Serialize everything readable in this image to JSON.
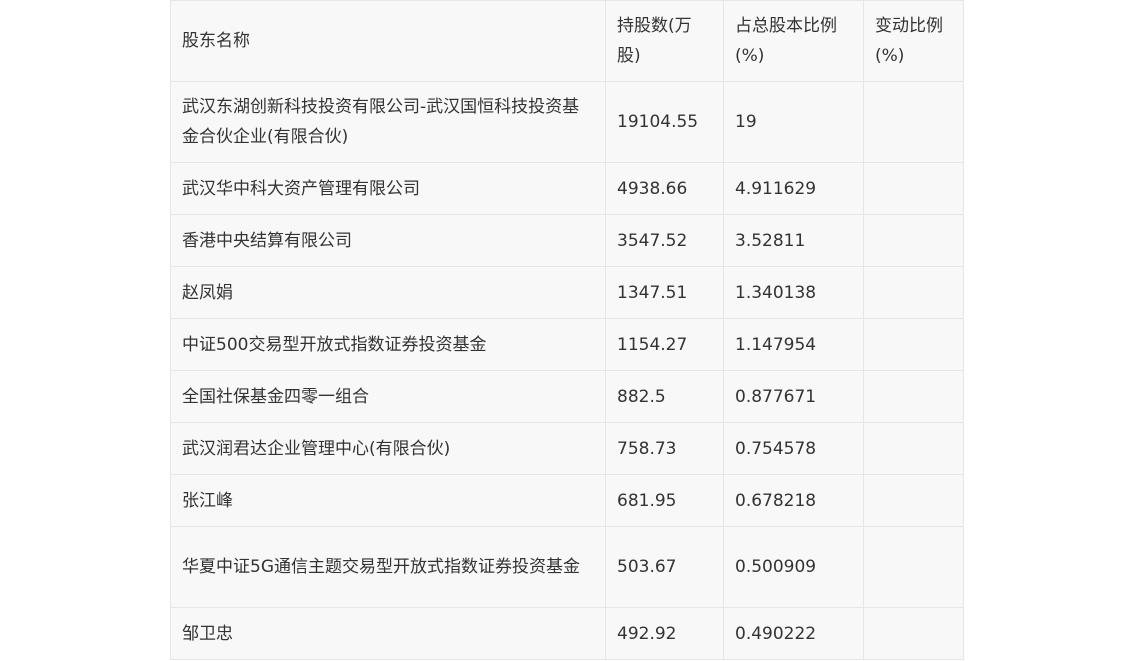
{
  "table": {
    "headers": [
      "股东名称",
      "持股数(万股)",
      "占总股本比例(%)",
      "变动比例(%)"
    ],
    "rows": [
      {
        "name": "武汉东湖创新科技投资有限公司-武汉国恒科技投资基金合伙企业(有限合伙)",
        "shares": "19104.55",
        "ratio": "19",
        "change": ""
      },
      {
        "name": "武汉华中科大资产管理有限公司",
        "shares": "4938.66",
        "ratio": "4.911629",
        "change": ""
      },
      {
        "name": "香港中央结算有限公司",
        "shares": "3547.52",
        "ratio": "3.52811",
        "change": ""
      },
      {
        "name": "赵凤娟",
        "shares": "1347.51",
        "ratio": "1.340138",
        "change": ""
      },
      {
        "name": "中证500交易型开放式指数证券投资基金",
        "shares": "1154.27",
        "ratio": "1.147954",
        "change": ""
      },
      {
        "name": "全国社保基金四零一组合",
        "shares": "882.5",
        "ratio": "0.877671",
        "change": ""
      },
      {
        "name": "武汉润君达企业管理中心(有限合伙)",
        "shares": "758.73",
        "ratio": "0.754578",
        "change": ""
      },
      {
        "name": "张江峰",
        "shares": "681.95",
        "ratio": "0.678218",
        "change": ""
      },
      {
        "name": "华夏中证5G通信主题交易型开放式指数证券投资基金",
        "shares": "503.67",
        "ratio": "0.500909",
        "change": ""
      },
      {
        "name": "邹卫忠",
        "shares": "492.92",
        "ratio": "0.490222",
        "change": ""
      }
    ]
  }
}
